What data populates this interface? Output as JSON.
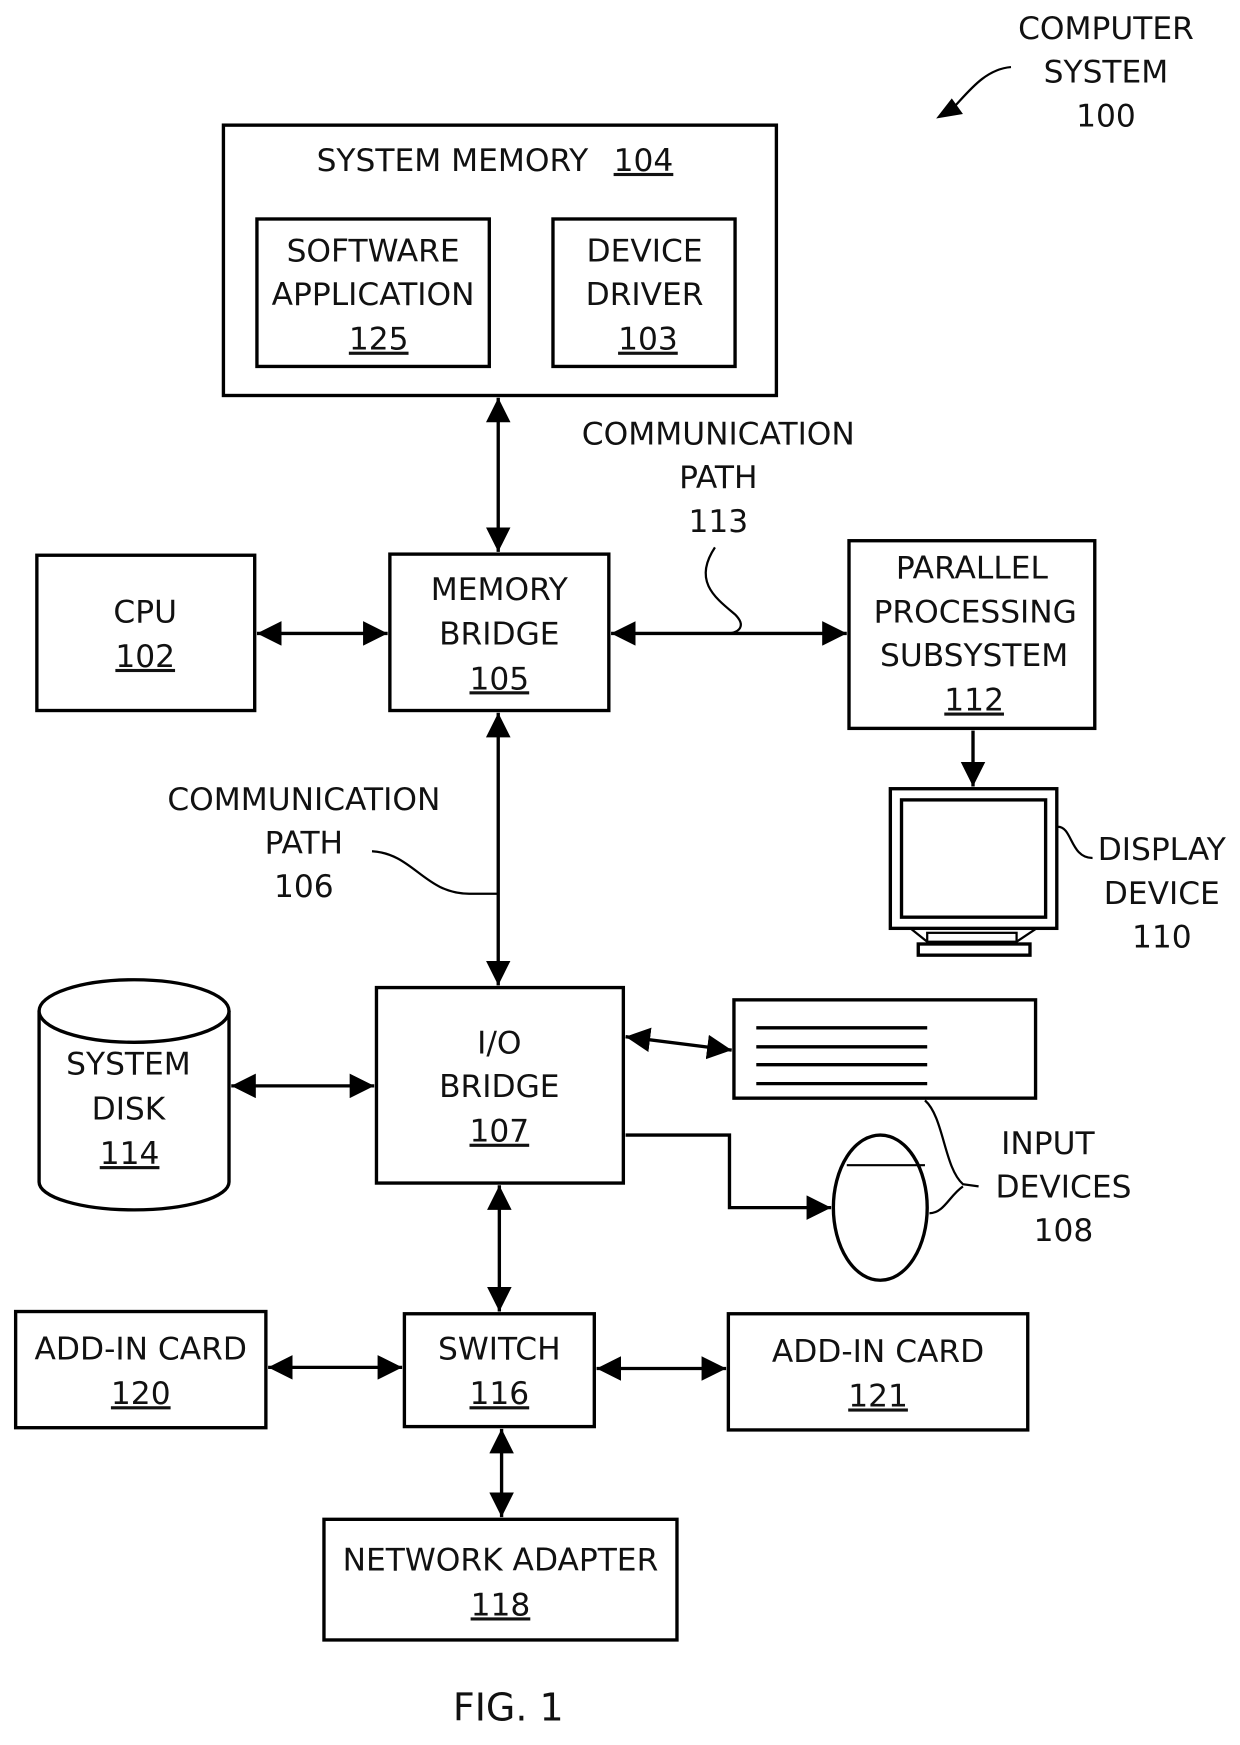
{
  "title": {
    "line1": "COMPUTER",
    "line2": "SYSTEM",
    "ref": "100"
  },
  "figure_caption": "FIG. 1",
  "nodes": {
    "system_memory": {
      "label": "SYSTEM MEMORY",
      "ref": "104"
    },
    "software_application": {
      "line1": "SOFTWARE",
      "line2": "APPLICATION",
      "ref": "125"
    },
    "device_driver": {
      "line1": "DEVICE",
      "line2": "DRIVER",
      "ref": "103"
    },
    "cpu": {
      "line1": "CPU",
      "ref": "102"
    },
    "memory_bridge": {
      "line1": "MEMORY",
      "line2": "BRIDGE",
      "ref": "105"
    },
    "parallel_processing": {
      "line1": "PARALLEL",
      "line2": "PROCESSING",
      "line3": "SUBSYSTEM",
      "ref": "112"
    },
    "display_device": {
      "line1": "DISPLAY",
      "line2": "DEVICE",
      "ref": "110"
    },
    "system_disk": {
      "line1": "SYSTEM",
      "line2": "DISK",
      "ref": "114"
    },
    "io_bridge": {
      "line1": "I/O",
      "line2": "BRIDGE",
      "ref": "107"
    },
    "input_devices": {
      "line1": "INPUT",
      "line2": "DEVICES",
      "ref": "108"
    },
    "add_in_card_120": {
      "line1": "ADD-IN CARD",
      "ref": "120"
    },
    "switch": {
      "line1": "SWITCH",
      "ref": "116"
    },
    "add_in_card_121": {
      "line1": "ADD-IN CARD",
      "ref": "121"
    },
    "network_adapter": {
      "line1": "NETWORK ADAPTER",
      "ref": "118"
    }
  },
  "paths": {
    "path_113": {
      "line1": "COMMUNICATION",
      "line2": "PATH",
      "ref": "113"
    },
    "path_106": {
      "line1": "COMMUNICATION",
      "line2": "PATH",
      "ref": "106"
    }
  }
}
